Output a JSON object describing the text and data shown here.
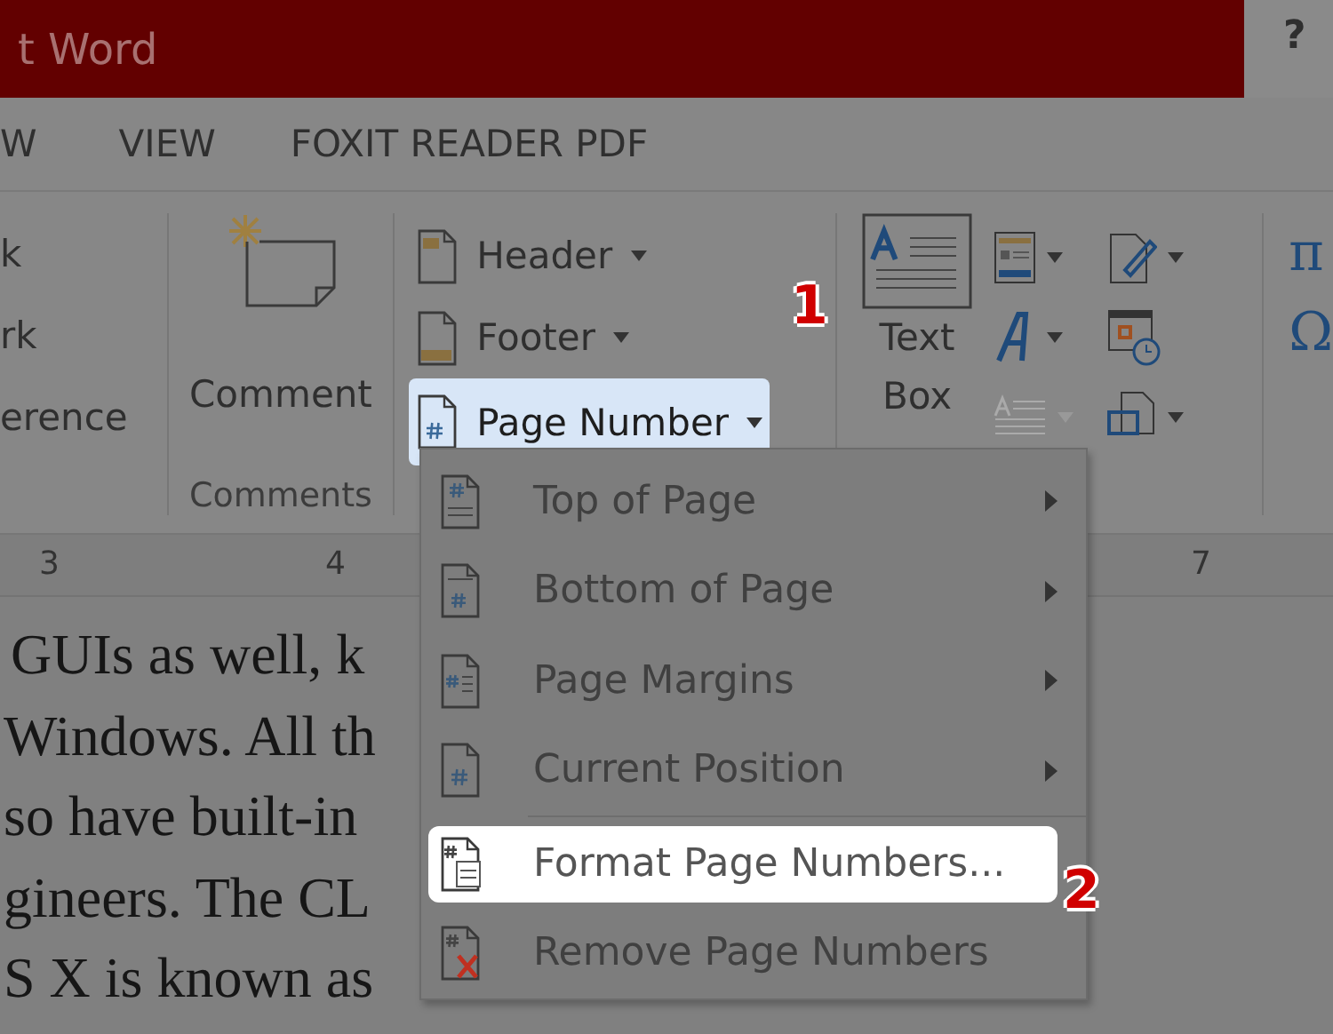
{
  "window": {
    "title": "t Word",
    "help": "?"
  },
  "tabs": [
    {
      "label": "W",
      "selected": false
    },
    {
      "label": "VIEW",
      "selected": false
    },
    {
      "label": "FOXIT READER PDF",
      "selected": false
    }
  ],
  "ribbon": {
    "partial_items": [
      "k",
      "rk",
      "erence"
    ],
    "comment_button": "Comment",
    "comments_label": "Comments",
    "header_footer": [
      {
        "label": "Header",
        "kind": "header",
        "selected": false
      },
      {
        "label": "Footer",
        "kind": "footer",
        "selected": false
      },
      {
        "label": "Page Number",
        "kind": "page-number",
        "selected": true
      }
    ],
    "text_box": [
      "Text",
      "Box"
    ],
    "symbols": [
      "π",
      "Ω"
    ]
  },
  "ruler": [
    "3",
    "4",
    "7"
  ],
  "document": {
    "lines": [
      "GUIs as well, k",
      "Windows. All th",
      "so have built-in",
      "gineers. The CL",
      "S X is known as"
    ]
  },
  "menu": {
    "items": [
      {
        "label": "Top of Page",
        "kind": "top",
        "submenu": true,
        "selected": false
      },
      {
        "label": "Bottom of Page",
        "kind": "bottom",
        "submenu": true,
        "selected": false
      },
      {
        "label": "Page Margins",
        "kind": "margins",
        "submenu": true,
        "selected": false
      },
      {
        "label": "Current Position",
        "kind": "current",
        "submenu": true,
        "selected": false
      },
      {
        "label": "Format Page Numbers...",
        "kind": "format",
        "submenu": false,
        "selected": true
      },
      {
        "label": "Remove Page Numbers",
        "kind": "remove",
        "submenu": false,
        "selected": false
      }
    ]
  },
  "steps": [
    "1",
    "2"
  ]
}
